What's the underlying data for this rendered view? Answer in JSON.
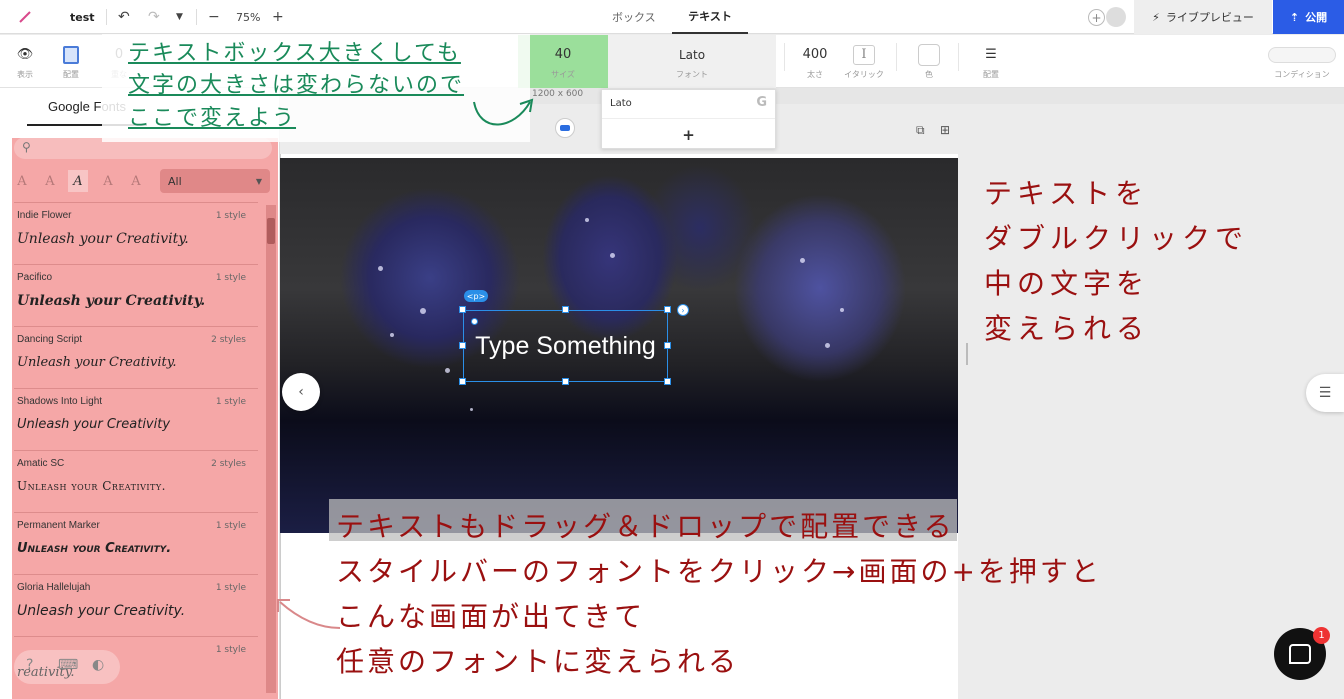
{
  "topbar": {
    "doc_title": "test",
    "zoom": "75%",
    "tabs": [
      "ボックス",
      "テキスト"
    ],
    "preview_label": "ライブプレビュー",
    "publish_label": "公開"
  },
  "stylebar": {
    "view_label": "表示",
    "place_label": "配置",
    "overlap_label": "重な",
    "size_value": "40",
    "size_label": "サイズ",
    "font_value": "Lato",
    "font_label": "フォント",
    "weight_value": "400",
    "weight_label": "太さ",
    "italic_glyph": "I",
    "italic_label": "イタリック",
    "color_label": "色",
    "align_label": "配置",
    "condition_label": "コンディション"
  },
  "canvas": {
    "size_label": "1200 x 600",
    "element_tag": "<p>",
    "text_content": "Type Something"
  },
  "font_popup": {
    "current_font": "Lato",
    "add_glyph": "+"
  },
  "left_panel": {
    "tab_label": "Google Fonts",
    "category": "All",
    "fonts": [
      {
        "name": "Indie Flower",
        "styles": "1 style",
        "preview": "Unleash your Creativity."
      },
      {
        "name": "Pacifico",
        "styles": "1 style",
        "preview": "Unleash your Creativity."
      },
      {
        "name": "Dancing Script",
        "styles": "2 styles",
        "preview": "Unleash your Creativity."
      },
      {
        "name": "Shadows Into Light",
        "styles": "1 style",
        "preview": "Unleash your Creativity"
      },
      {
        "name": "Amatic SC",
        "styles": "2 styles",
        "preview": "Unleash your Creativity."
      },
      {
        "name": "Permanent Marker",
        "styles": "1 style",
        "preview": "Unleash your Creativity."
      },
      {
        "name": "Gloria Hallelujah",
        "styles": "1 style",
        "preview": "Unleash your Creativity."
      },
      {
        "name": "",
        "styles": "1 style",
        "preview": "reativity."
      }
    ]
  },
  "chat": {
    "badge_count": "1"
  },
  "annotations": {
    "top": [
      "テキストボックス大きくしても",
      "文字の大きさは変わらないので",
      "ここで変えよう"
    ],
    "right": [
      "テキストを",
      "ダブルクリックで",
      "中の文字を",
      "変えられる"
    ],
    "bottom": [
      "テキストもドラッグ＆ドロップで配置できる",
      "スタイルバーのフォントをクリック→画面の+を押すと",
      "こんな画面が出てきて",
      "任意のフォントに変えられる"
    ]
  },
  "colors": {
    "accent": "#2b5ce6",
    "selection": "#2b8fe8",
    "annotation_green": "#1a8a5a",
    "annotation_red": "#9a1010",
    "highlight_green": "#9bdf9b",
    "highlight_pink": "#f07878"
  }
}
